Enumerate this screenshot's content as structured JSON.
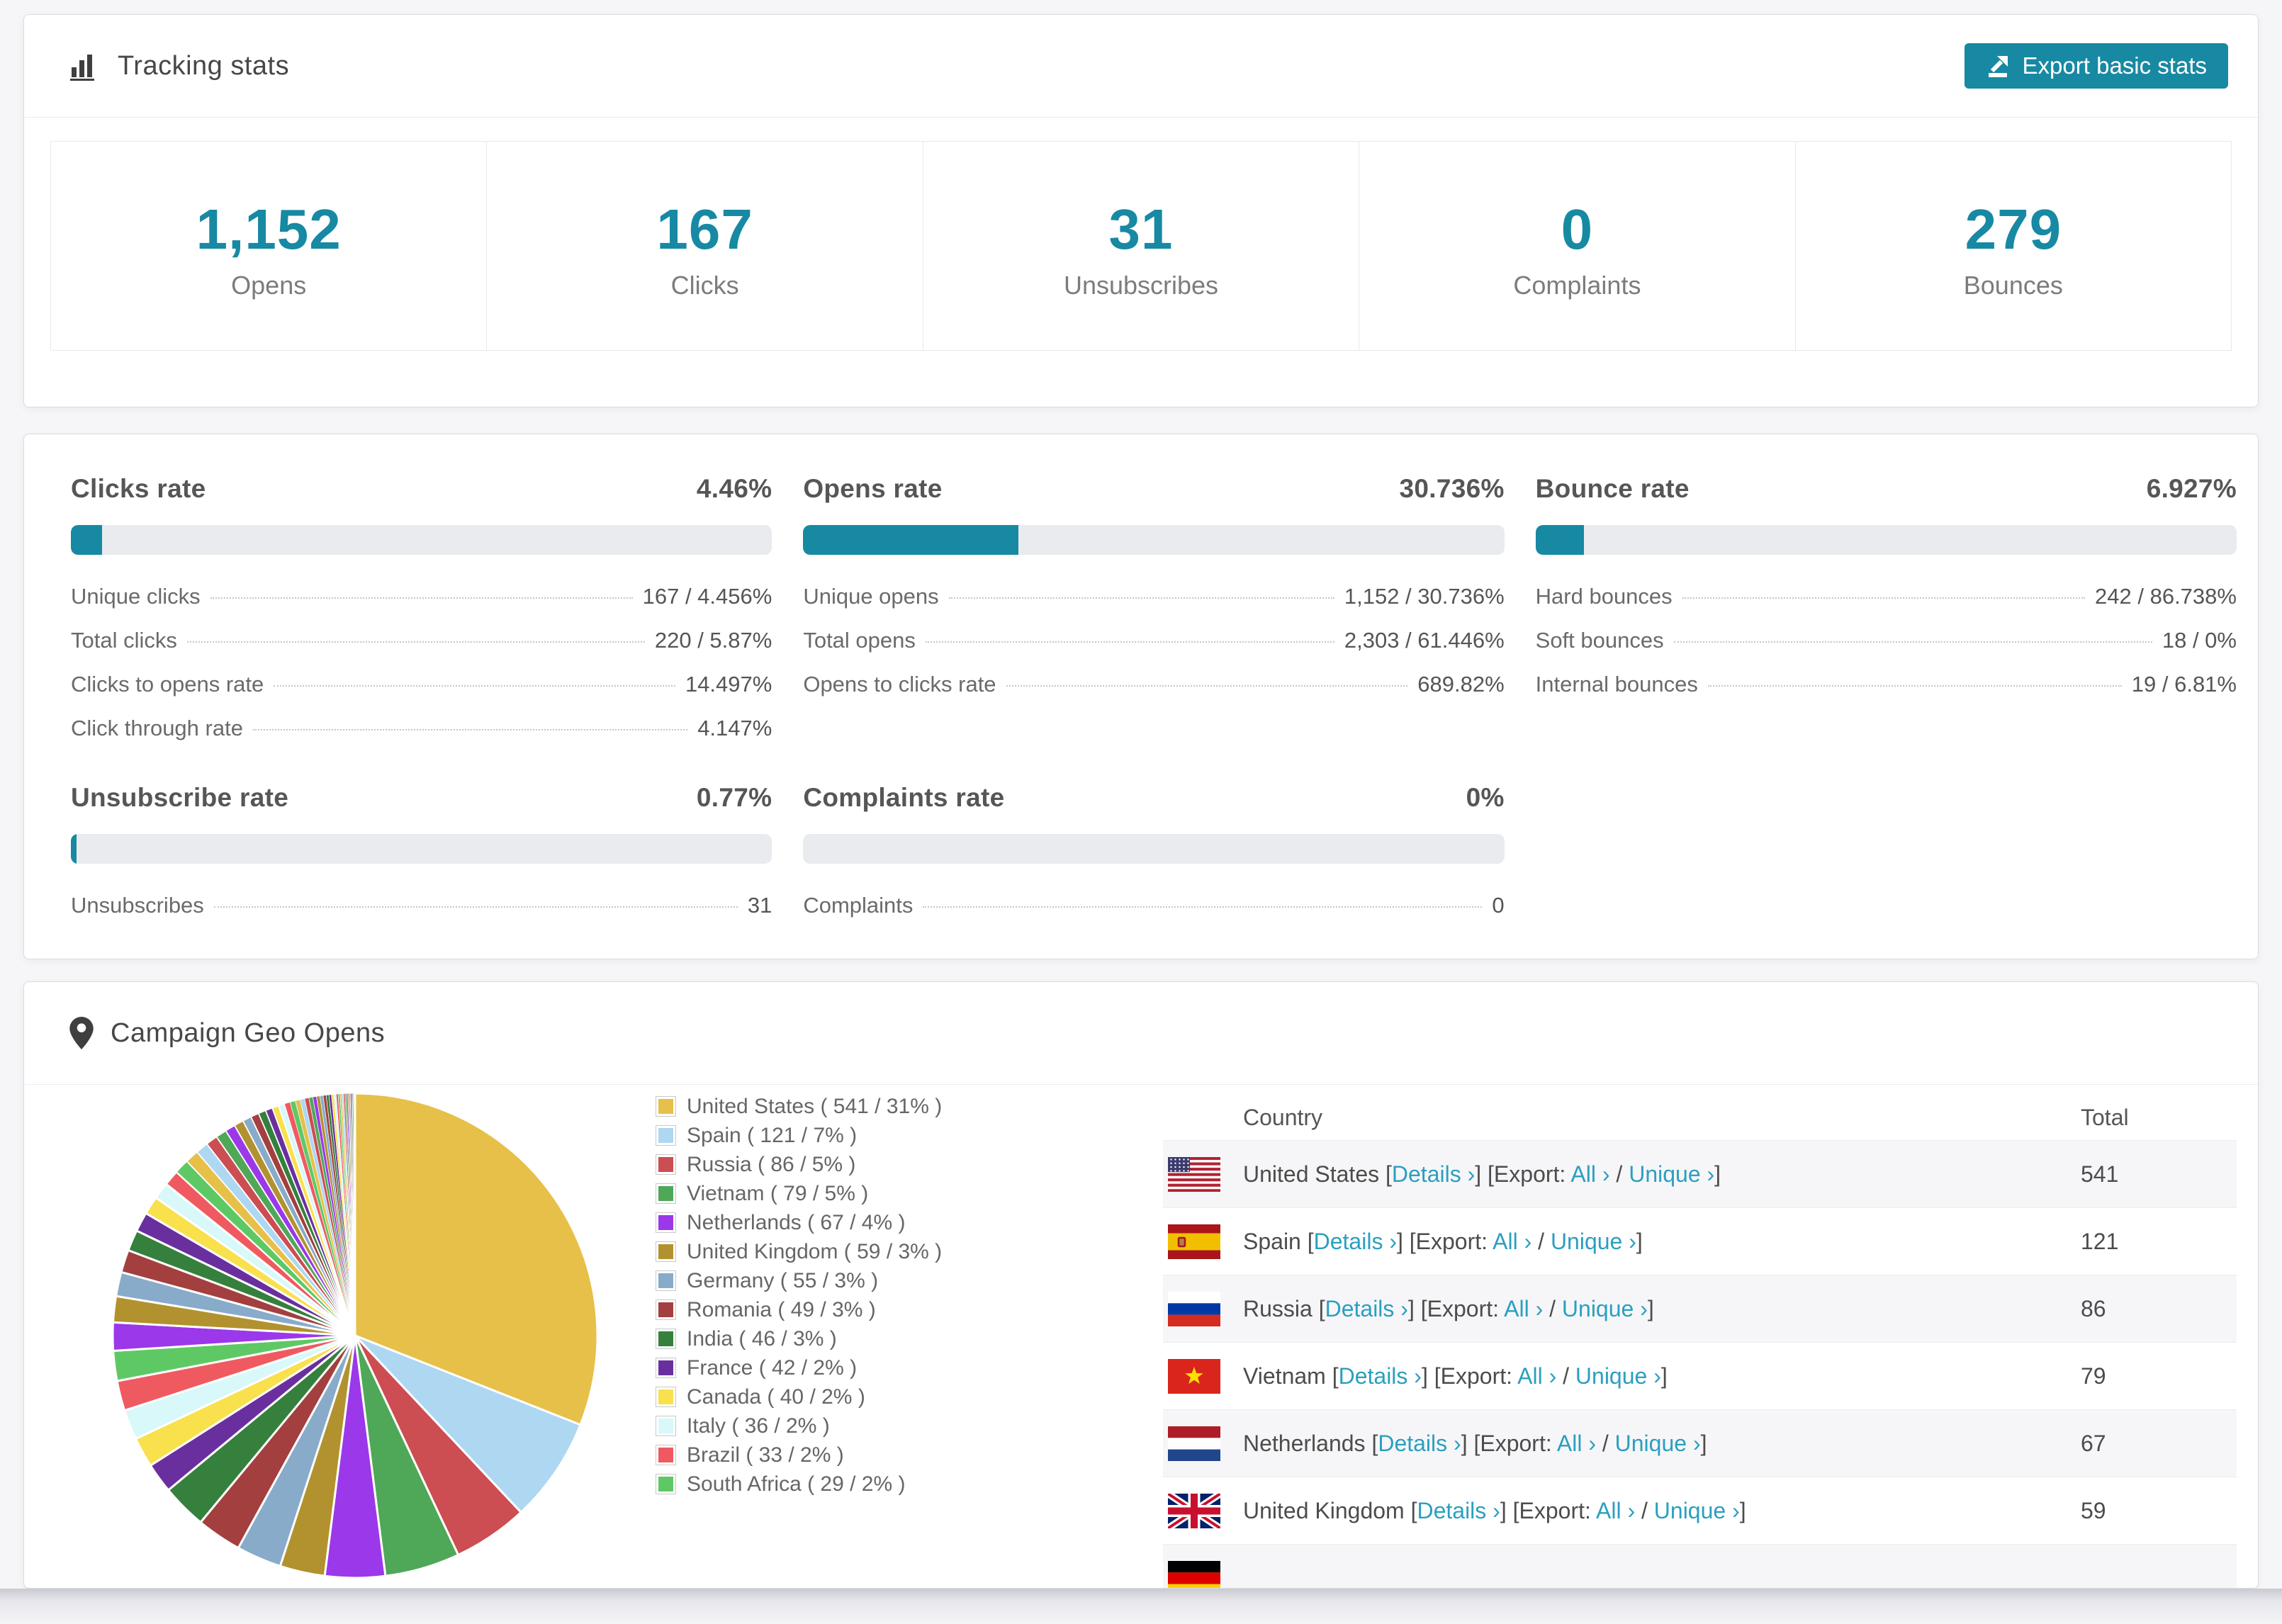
{
  "colors": {
    "accent": "#1789a3",
    "link": "#2b9fc0",
    "stat_number": "#1789a3",
    "bar_track": "#e9ebef",
    "page_bg": "#f6f6f9"
  },
  "tracking": {
    "title": "Tracking stats",
    "export_button": "Export basic stats",
    "summary": [
      {
        "value": "1,152",
        "label": "Opens"
      },
      {
        "value": "167",
        "label": "Clicks"
      },
      {
        "value": "31",
        "label": "Unsubscribes"
      },
      {
        "value": "0",
        "label": "Complaints"
      },
      {
        "value": "279",
        "label": "Bounces"
      }
    ]
  },
  "rates": [
    {
      "title": "Clicks rate",
      "value": "4.46%",
      "percent": 4.46,
      "rows": [
        {
          "label": "Unique clicks",
          "value": "167 / 4.456%"
        },
        {
          "label": "Total clicks",
          "value": "220 / 5.87%"
        },
        {
          "label": "Clicks to opens rate",
          "value": "14.497%"
        },
        {
          "label": "Click through rate",
          "value": "4.147%"
        }
      ]
    },
    {
      "title": "Opens rate",
      "value": "30.736%",
      "percent": 30.736,
      "rows": [
        {
          "label": "Unique opens",
          "value": "1,152 / 30.736%"
        },
        {
          "label": "Total opens",
          "value": "2,303 / 61.446%"
        },
        {
          "label": "Opens to clicks rate",
          "value": "689.82%"
        }
      ]
    },
    {
      "title": "Bounce rate",
      "value": "6.927%",
      "percent": 6.927,
      "rows": [
        {
          "label": "Hard bounces",
          "value": "242 / 86.738%"
        },
        {
          "label": "Soft bounces",
          "value": "18 / 0%"
        },
        {
          "label": "Internal bounces",
          "value": "19 / 6.81%"
        }
      ]
    },
    {
      "title": "Unsubscribe rate",
      "value": "0.77%",
      "percent": 0.77,
      "rows": [
        {
          "label": "Unsubscribes",
          "value": "31"
        }
      ]
    },
    {
      "title": "Complaints rate",
      "value": "0%",
      "percent": 0,
      "rows": [
        {
          "label": "Complaints",
          "value": "0"
        }
      ]
    }
  ],
  "geo": {
    "title": "Campaign Geo Opens",
    "legend": [
      {
        "label": "United States ( 541 / 31% )"
      },
      {
        "label": "Spain ( 121 / 7% )"
      },
      {
        "label": "Russia ( 86 / 5% )"
      },
      {
        "label": "Vietnam ( 79 / 5% )"
      },
      {
        "label": "Netherlands ( 67 / 4% )"
      },
      {
        "label": "United Kingdom ( 59 / 3% )"
      },
      {
        "label": "Germany ( 55 / 3% )"
      },
      {
        "label": "Romania ( 49 / 3% )"
      },
      {
        "label": "India ( 46 / 3% )"
      },
      {
        "label": "France ( 42 / 2% )"
      },
      {
        "label": "Canada ( 40 / 2% )"
      },
      {
        "label": "Italy ( 36 / 2% )"
      },
      {
        "label": "Brazil ( 33 / 2% )"
      },
      {
        "label": "South Africa ( 29 / 2% )"
      }
    ],
    "chart_data": {
      "type": "pie",
      "title": "Campaign Geo Opens",
      "labels": [
        "United States",
        "Spain",
        "Russia",
        "Vietnam",
        "Netherlands",
        "United Kingdom",
        "Germany",
        "Romania",
        "India",
        "France",
        "Canada",
        "Italy",
        "Brazil",
        "South Africa"
      ],
      "values": [
        541,
        121,
        86,
        79,
        67,
        59,
        55,
        49,
        46,
        42,
        40,
        36,
        33,
        29
      ],
      "percents": [
        31,
        7,
        5,
        5,
        4,
        3,
        3,
        3,
        3,
        2,
        2,
        2,
        2,
        2
      ],
      "colors": [
        "#e7c04a",
        "#aed7f2",
        "#cc4d52",
        "#4fa858",
        "#9b38ea",
        "#b2922f",
        "#88abca",
        "#a33f3f",
        "#35803c",
        "#6a2f9e",
        "#f9e04d",
        "#d8f8fa",
        "#ef5a60",
        "#5ec964"
      ],
      "other_percent": 26,
      "legend_position": "right",
      "start_angle": 0,
      "direction": "clockwise"
    },
    "table": {
      "columns": [
        "Country",
        "Total"
      ],
      "links": {
        "details": "Details ›",
        "export_prefix": "Export:",
        "all": "All ›",
        "unique": "Unique ›"
      },
      "rows": [
        {
          "flag": "us",
          "country": "United States",
          "total": "541"
        },
        {
          "flag": "es",
          "country": "Spain",
          "total": "121"
        },
        {
          "flag": "ru",
          "country": "Russia",
          "total": "86"
        },
        {
          "flag": "vn",
          "country": "Vietnam",
          "total": "79"
        },
        {
          "flag": "nl",
          "country": "Netherlands",
          "total": "67"
        },
        {
          "flag": "gb",
          "country": "United Kingdom",
          "total": "59"
        },
        {
          "flag": "de",
          "country": "",
          "total": "",
          "partial": true
        }
      ]
    }
  }
}
